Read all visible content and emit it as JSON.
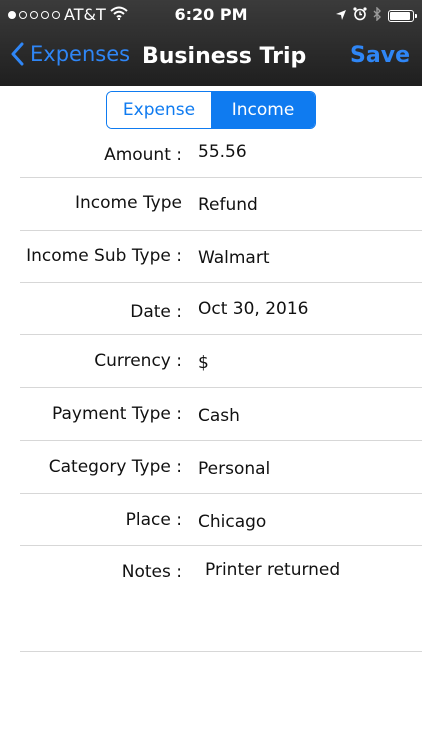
{
  "status_bar": {
    "carrier": "AT&T",
    "time": "6:20 PM",
    "signal_icon": "signal-dots-icon",
    "wifi_icon": "wifi-icon",
    "location_icon": "location-arrow-icon",
    "alarm_icon": "alarm-clock-icon",
    "bluetooth_icon": "bluetooth-icon",
    "battery_icon": "battery-icon",
    "battery_level_percent": 90
  },
  "nav": {
    "back_label": "Expenses",
    "title": "Business Trip",
    "save_label": "Save",
    "accent_color": "#2f86f6"
  },
  "segment": {
    "options": [
      "Expense",
      "Income"
    ],
    "selected": "Income",
    "color": "#0f7bf0"
  },
  "form": {
    "amount": {
      "label": "Amount :",
      "value": "55.56"
    },
    "income_type": {
      "label": "Income Type",
      "value": "Refund"
    },
    "income_sub_type": {
      "label": "Income Sub Type :",
      "value": "Walmart"
    },
    "date": {
      "label": "Date :",
      "value": "Oct 30, 2016"
    },
    "currency": {
      "label": "Currency :",
      "value": "$"
    },
    "payment_type": {
      "label": "Payment Type :",
      "value": "Cash"
    },
    "category_type": {
      "label": "Category Type :",
      "value": "Personal"
    },
    "place": {
      "label": "Place :",
      "value": "Chicago"
    },
    "notes": {
      "label": "Notes :",
      "value": "Printer returned"
    }
  }
}
